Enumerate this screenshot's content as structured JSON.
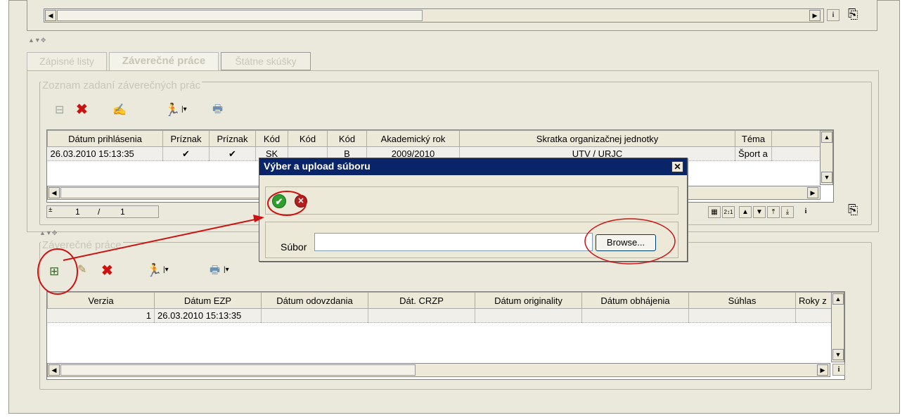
{
  "tabs": [
    "Zápisné listy",
    "Záverečné práce",
    "Štátne skúšky"
  ],
  "zadania": {
    "title": "Zoznam zadaní záverečných prác",
    "headers": [
      "Dátum prihlásenia",
      "Príznak",
      "Príznak",
      "Kód",
      "Kód",
      "Kód",
      "Akademický rok",
      "Skratka organizačnej jednotky",
      "Téma"
    ],
    "row": [
      "26.03.2010 15:13:35",
      "✔",
      "✔",
      "SK",
      "",
      "B",
      "2009/2010",
      "UTV / URJC",
      "Šport a"
    ],
    "pager": {
      "current": "1",
      "sep": "/",
      "total": "1"
    }
  },
  "prace": {
    "title": "Záverečné práce",
    "headers": [
      "Verzia",
      "Dátum EZP",
      "Dátum odovzdania",
      "Dát. CRZP",
      "Dátum originality",
      "Dátum obhájenia",
      "Súhlas",
      "Roky z"
    ],
    "row": [
      "1",
      "26.03.2010 15:13:35",
      "",
      "",
      "",
      "",
      "",
      ""
    ]
  },
  "dialog": {
    "title": "Výber a upload súboru",
    "file_label": "Súbor",
    "file_value": "",
    "browse_label": "Browse..."
  },
  "icons": {
    "info": "i",
    "close": "✕",
    "sort": "2↕1"
  },
  "colors": {
    "dialog_title_bar": "#0a246a",
    "frame_bg": "#ebe9db",
    "annotation_red": "#cc1111",
    "ok_green": "#2e9e2e"
  }
}
